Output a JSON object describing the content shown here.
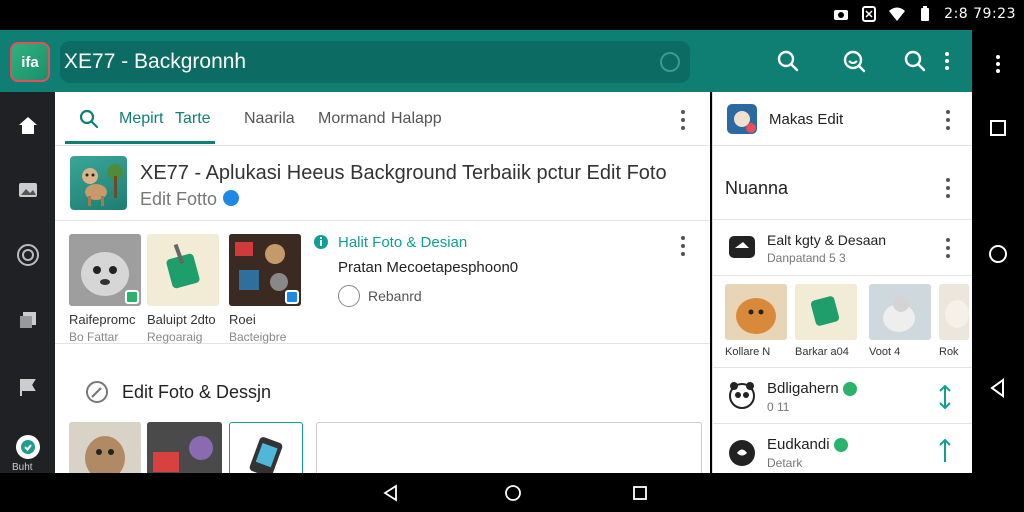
{
  "status": {
    "time": "2:8 79:23"
  },
  "colors": {
    "accent": "#0f7f74",
    "accent_light": "#0f9f94",
    "badge_blue": "#1e88e5",
    "badge_green": "#29b36b"
  },
  "appbar": {
    "logo_text": "ifa",
    "title": "XE77 - Backgronnh",
    "icons": [
      "search-icon",
      "face-scan-icon",
      "search-icon",
      "more-vert-icon"
    ]
  },
  "tabs": [
    {
      "label": "Mepirt",
      "active": true
    },
    {
      "label": "Tarte",
      "active": true
    },
    {
      "label": "Naarila",
      "active": false
    },
    {
      "label": "Mormand",
      "active": false
    },
    {
      "label": "Halapp",
      "active": false
    }
  ],
  "app_info": {
    "title": "XE77 - Aplukasi Heeus Background Terbaiik pctur Edit Foto",
    "subtitle": "Edit Fotto"
  },
  "gallery": {
    "items": [
      {
        "label": "Raifepromc",
        "sub": "Bo Fattar"
      },
      {
        "label": "Baluipt 2dto",
        "sub": "Regoaraig"
      },
      {
        "label": "Roei",
        "sub": "Bacteigbre"
      }
    ]
  },
  "detail": {
    "title": "Halit Foto & Desian",
    "subtitle": "Pratan Mecoetapesphoon0",
    "action": "Rebanrd"
  },
  "section2": {
    "title": "Edit Foto & Dessjn"
  },
  "side": {
    "header": "Makas Edit",
    "section": "Nuanna",
    "item1": {
      "title": "Ealt kgty & Desaan",
      "sub": "Danpatand  5 3"
    },
    "thumbs": [
      {
        "label": "Kollare  N"
      },
      {
        "label": "Barkar a04"
      },
      {
        "label": "Voot    4"
      },
      {
        "label": "Rok"
      }
    ],
    "item2": {
      "title": "Bdligahern",
      "sub": "0 11"
    },
    "item3": {
      "title": "Eudkandi",
      "sub": "Detark"
    }
  },
  "rail": {
    "icons": [
      "home-icon",
      "image-icon",
      "target-icon",
      "layers-icon",
      "flag-icon",
      "profile-icon"
    ],
    "bottom_label": "Buht"
  }
}
